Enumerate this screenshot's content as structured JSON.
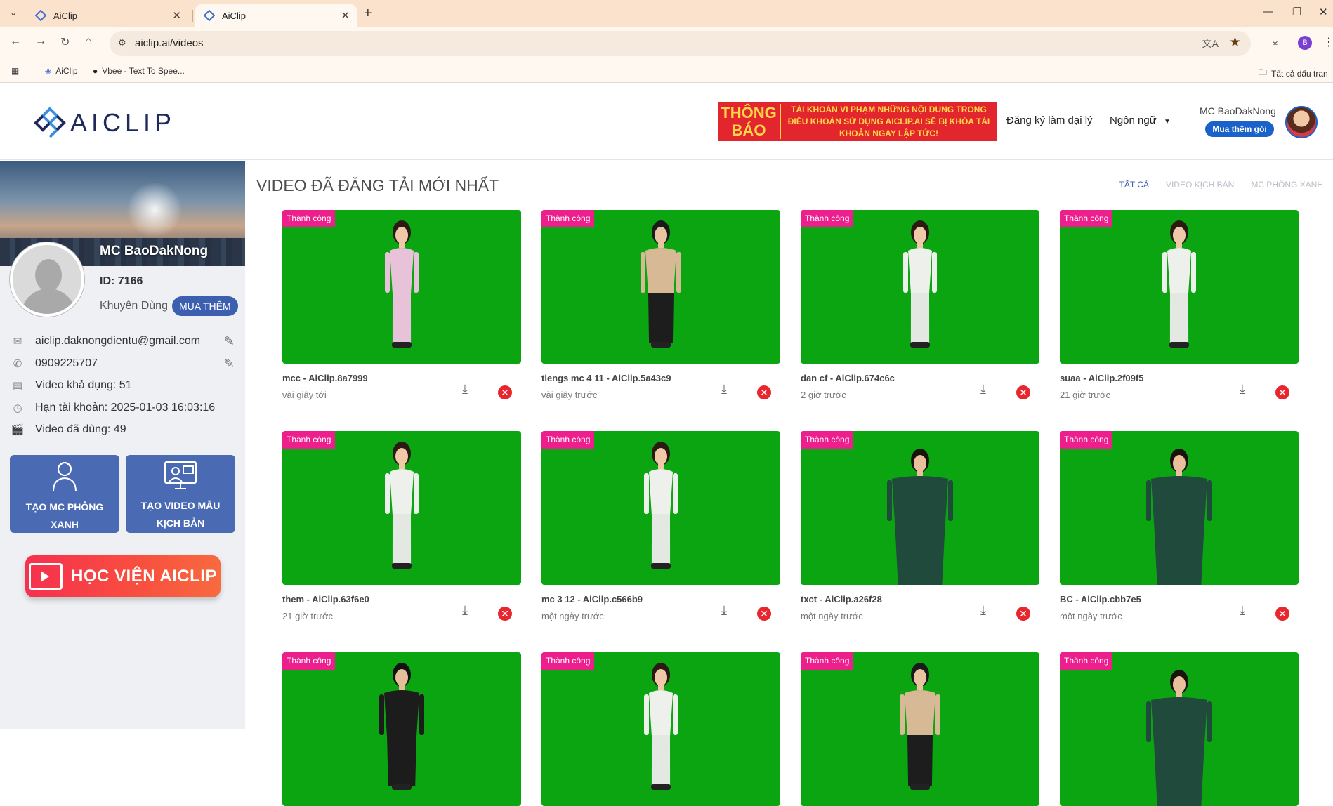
{
  "browser": {
    "tabs": [
      {
        "title": "AiClip",
        "active": false
      },
      {
        "title": "AiClip",
        "active": true
      }
    ],
    "url": "aiclip.ai/videos",
    "bookmarks": [
      {
        "label": "AiClip"
      },
      {
        "label": "Vbee - Text To Spee..."
      }
    ],
    "all_bookmarks": "Tất cả dấu tran",
    "profile_initial": "B"
  },
  "header": {
    "logo_text": "AICLIP",
    "notice_title": "THÔNG BÁO",
    "notice_text": "TÀI KHOẢN VI PHẠM NHỮNG NỘI DUNG TRONG ĐIỀU KHOẢN SỬ DỤNG AICLIP.AI SẼ BỊ KHÓA TÀI KHOẢN NGAY LẬP TỨC!",
    "agent_link": "Đăng ký làm đại lý",
    "language_label": "Ngôn ngữ",
    "user_name": "MC BaoDakNong",
    "buy_package": "Mua thêm gói"
  },
  "sidebar": {
    "name": "MC BaoDakNong",
    "id_text": "ID: 7166",
    "plan": "Khuyên Dùng",
    "buy_more": "MUA THÊM",
    "email": "aiclip.daknongdientu@gmail.com",
    "phone": "0909225707",
    "videos_available": "Video khả dụng: 51",
    "account_expiry": "Hạn tài khoản: 2025-01-03 16:03:16",
    "videos_used": "Video đã dùng: 49",
    "btn_green_mc_line1": "TẠO MC PHÔNG",
    "btn_green_mc_line2": "XANH",
    "btn_script_line1": "TẠO VIDEO MẪU",
    "btn_script_line2": "KỊCH BẢN",
    "academy": "HỌC VIỆN AICLIP"
  },
  "main": {
    "title": "VIDEO ĐÃ ĐĂNG TẢI MỚI NHẤT",
    "filters": [
      "TẤT CẢ",
      "VIDEO KỊCH BẢN",
      "MC PHÔNG XANH"
    ],
    "colors": {
      "green_screen": "#0aa510",
      "badge": "#ec1f8c",
      "accent": "#3d5fb0"
    },
    "videos": [
      {
        "status": "Thành công",
        "name": "mcc - AiClip.8a7999",
        "time": "vài giây tới",
        "figure": "pink-dress"
      },
      {
        "status": "Thành công",
        "name": "tiengs mc 4 11 - AiClip.5a43c9",
        "time": "vài giây trước",
        "figure": "beige-suit"
      },
      {
        "status": "Thành công",
        "name": "dan cf - AiClip.674c6c",
        "time": "2 giờ trước",
        "figure": "white-aodai"
      },
      {
        "status": "Thành công",
        "name": "suaa - AiClip.2f09f5",
        "time": "21 giờ trước",
        "figure": "white-aodai"
      },
      {
        "status": "Thành công",
        "name": "them - AiClip.63f6e0",
        "time": "21 giờ trước",
        "figure": "white-aodai"
      },
      {
        "status": "Thành công",
        "name": "mc 3 12 - AiClip.c566b9",
        "time": "một ngày trước",
        "figure": "white-aodai"
      },
      {
        "status": "Thành công",
        "name": "txct - AiClip.a26f28",
        "time": "một ngày trước",
        "figure": "green-suit"
      },
      {
        "status": "Thành công",
        "name": "BC - AiClip.cbb7e5",
        "time": "một ngày trước",
        "figure": "green-suit"
      },
      {
        "status": "Thành công",
        "name": "",
        "time": "",
        "figure": "black-suit"
      },
      {
        "status": "Thành công",
        "name": "",
        "time": "",
        "figure": "white-aodai"
      },
      {
        "status": "Thành công",
        "name": "",
        "time": "",
        "figure": "beige-suit"
      },
      {
        "status": "Thành công",
        "name": "",
        "time": "",
        "figure": "green-suit"
      }
    ]
  }
}
